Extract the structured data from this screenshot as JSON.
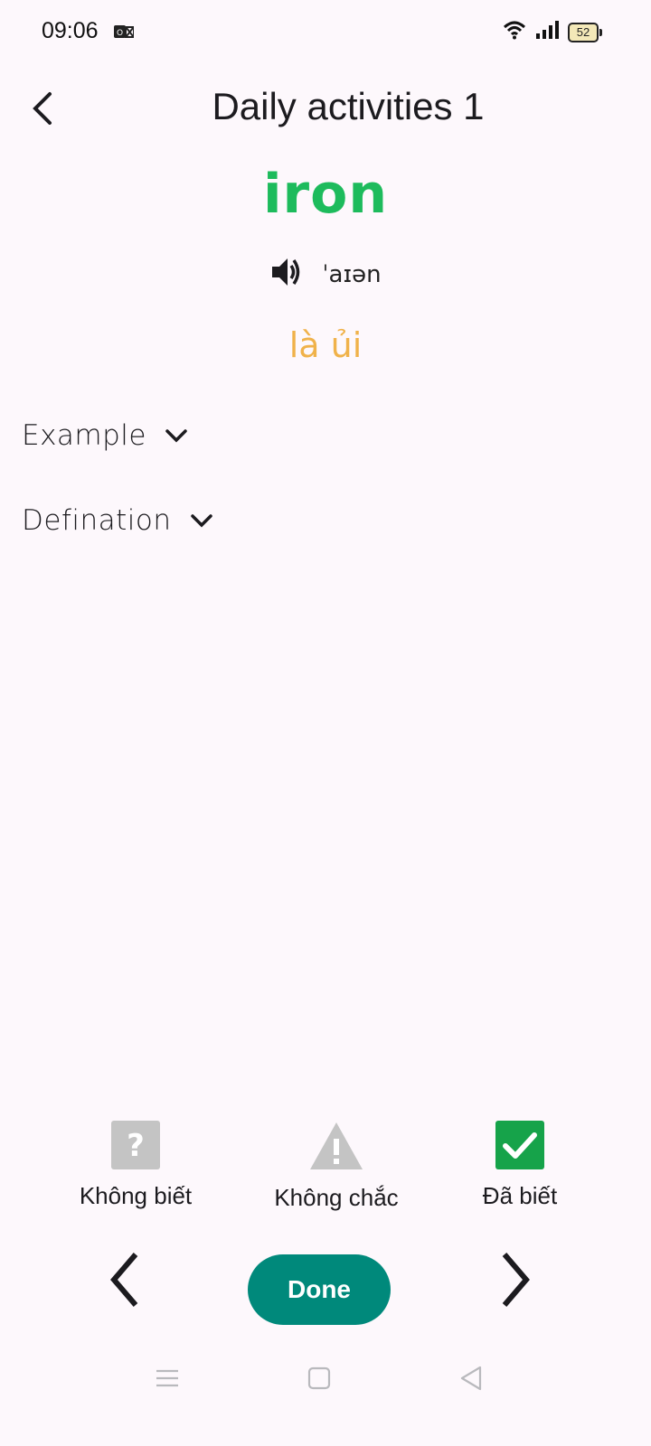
{
  "status_bar": {
    "time": "09:06",
    "battery": "52"
  },
  "header": {
    "title": "Daily activities 1"
  },
  "card": {
    "word": "iron",
    "ipa": "ˈaɪən",
    "meaning": "là ủi"
  },
  "sections": {
    "example_label": "Example",
    "definition_label": "Defination"
  },
  "choices": {
    "unknown_label": "Không biết",
    "unsure_label": "Không chắc",
    "known_label": "Đã biết"
  },
  "controls": {
    "done_label": "Done"
  },
  "colors": {
    "word": "#1dbb5c",
    "meaning": "#f0b24a",
    "done": "#00897b",
    "known": "#16a34a",
    "inactive_icon": "#c4c4c4"
  }
}
